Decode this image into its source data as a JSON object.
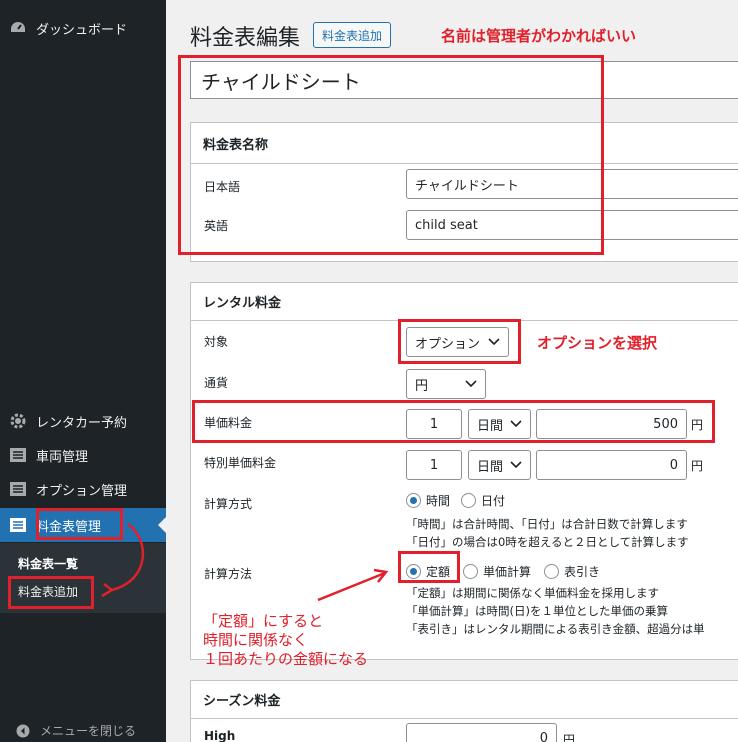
{
  "sidebar": {
    "dashboard": "ダッシュボード",
    "items": [
      {
        "label": "レンタカー予約",
        "icon": "gear-icon"
      },
      {
        "label": "車両管理",
        "icon": "list-icon"
      },
      {
        "label": "オプション管理",
        "icon": "list-icon"
      },
      {
        "label": "料金表管理",
        "icon": "list-icon"
      }
    ],
    "submenu": [
      "料金表一覧",
      "料金表追加"
    ],
    "collapse": "メニューを閉じる"
  },
  "header": {
    "title": "料金表編集",
    "add_new": "料金表追加"
  },
  "title_value": "チャイルドシート",
  "name_box": {
    "heading": "料金表名称",
    "jp_label": "日本語",
    "jp_value": "チャイルドシート",
    "en_label": "英語",
    "en_value": "child seat"
  },
  "rental_box": {
    "heading": "レンタル料金",
    "target_label": "対象",
    "target_value": "オプション",
    "currency_label": "通貨",
    "currency_value": "円",
    "unit_price_label": "単価料金",
    "unit_price_qty": "1",
    "unit_price_period": "日間",
    "unit_price_amount": "500",
    "special_label": "特別単価料金",
    "special_qty": "1",
    "special_period": "日間",
    "special_amount": "0",
    "yen": "円",
    "calc_mode_label": "計算方式",
    "calc_mode_opt1": "時間",
    "calc_mode_opt2": "日付",
    "calc_mode_note1": "「時間」は合計時間、「日付」は合計日数で計算します",
    "calc_mode_note2": "「日付」の場合は0時を超えると２日として計算します",
    "calc_method_label": "計算方法",
    "calc_method_opt1": "定額",
    "calc_method_opt2": "単価計算",
    "calc_method_opt3": "表引き",
    "calc_method_note1": "「定額」は期間に関係なく単価料金を採用します",
    "calc_method_note2": "「単価計算」は時間(日)を１単位とした単価の乗算",
    "calc_method_note3": "「表引き」はレンタル期間による表引き金額、超過分は単"
  },
  "season_box": {
    "heading": "シーズン料金",
    "high_label": "High",
    "high_value": "0",
    "yen": "円"
  },
  "annotations": {
    "name_note": "名前は管理者がわかればいい",
    "option_note": "オプションを選択",
    "fixed_note_1": "「定額」にすると",
    "fixed_note_2": "時間に関係なく",
    "fixed_note_3": "１回あたりの金額になる"
  },
  "colors": {
    "sidebar_bg": "#1d2327",
    "accent": "#2271b1",
    "annotation_red": "#e0202a"
  }
}
